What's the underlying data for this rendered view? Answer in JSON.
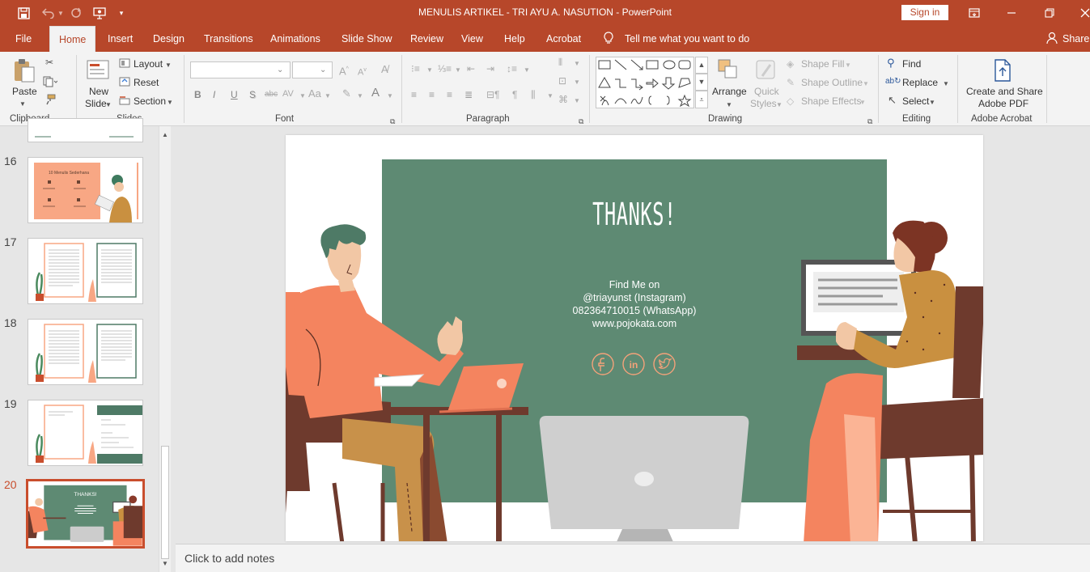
{
  "window": {
    "title": "MENULIS ARTIKEL - TRI AYU A. NASUTION  -  PowerPoint",
    "sign_in": "Sign in",
    "accent": "#b7472a"
  },
  "tabs": [
    "File",
    "Home",
    "Insert",
    "Design",
    "Transitions",
    "Animations",
    "Slide Show",
    "Review",
    "View",
    "Help",
    "Acrobat"
  ],
  "tell_me": "Tell me what you want to do",
  "share": "Share",
  "ribbon": {
    "clipboard": {
      "paste": "Paste",
      "label": "Clipboard"
    },
    "slides": {
      "new_slide_1": "New",
      "new_slide_2": "Slide",
      "layout": "Layout",
      "reset": "Reset",
      "section": "Section",
      "label": "Slides"
    },
    "font": {
      "label": "Font",
      "bold": "B",
      "italic": "I",
      "underline": "U",
      "shadow": "S",
      "strike": "abc",
      "spacing": "AV",
      "case": "Aa",
      "color": "A"
    },
    "paragraph": {
      "label": "Paragraph"
    },
    "drawing": {
      "arrange": "Arrange",
      "quick_1": "Quick",
      "quick_2": "Styles",
      "shape_fill": "Shape Fill",
      "shape_outline": "Shape Outline",
      "shape_effects": "Shape Effects",
      "label": "Drawing"
    },
    "editing": {
      "find": "Find",
      "replace": "Replace",
      "select": "Select",
      "label": "Editing"
    },
    "acrobat": {
      "create_1": "Create and Share",
      "create_2": "Adobe PDF",
      "label": "Adobe Acrobat"
    }
  },
  "thumbnails": [
    {
      "number": "16"
    },
    {
      "number": "17"
    },
    {
      "number": "18"
    },
    {
      "number": "19"
    },
    {
      "number": "20"
    }
  ],
  "slide": {
    "heading": "THANKS!",
    "find_me": "Find Me on",
    "instagram": "@triayunst (Instagram)",
    "whatsapp": "082364710015 (WhatsApp)",
    "website": "www.pojokata.com",
    "thumb16_title": "10 Menulis Sederhana"
  },
  "notes_placeholder": "Click to add notes"
}
